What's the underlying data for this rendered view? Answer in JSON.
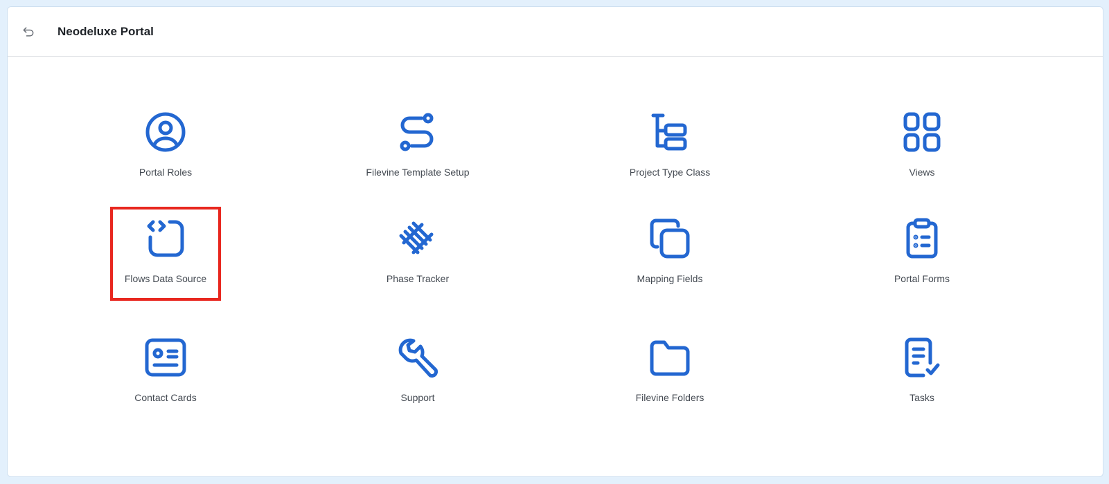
{
  "header": {
    "title": "Neodeluxe Portal",
    "back_icon": "return-arrow-icon"
  },
  "colors": {
    "accent": "#2367d1",
    "highlight": "#e8271f",
    "background": "#e3f0fc"
  },
  "tiles": [
    {
      "label": "Portal Roles",
      "icon": "user-circle-icon"
    },
    {
      "label": "Filevine Template Setup",
      "icon": "route-icon"
    },
    {
      "label": "Project Type Class",
      "icon": "hierarchy-icon"
    },
    {
      "label": "Views",
      "icon": "grid-icon"
    },
    {
      "label": "Flows Data Source",
      "icon": "code-square-icon",
      "selected": true
    },
    {
      "label": "Phase Tracker",
      "icon": "railway-track-icon"
    },
    {
      "label": "Mapping Fields",
      "icon": "copy-icon"
    },
    {
      "label": "Portal Forms",
      "icon": "clipboard-list-icon"
    },
    {
      "label": "Contact Cards",
      "icon": "id-card-icon"
    },
    {
      "label": "Support",
      "icon": "wrench-icon"
    },
    {
      "label": "Filevine Folders",
      "icon": "folder-icon"
    },
    {
      "label": "Tasks",
      "icon": "task-check-icon"
    }
  ]
}
